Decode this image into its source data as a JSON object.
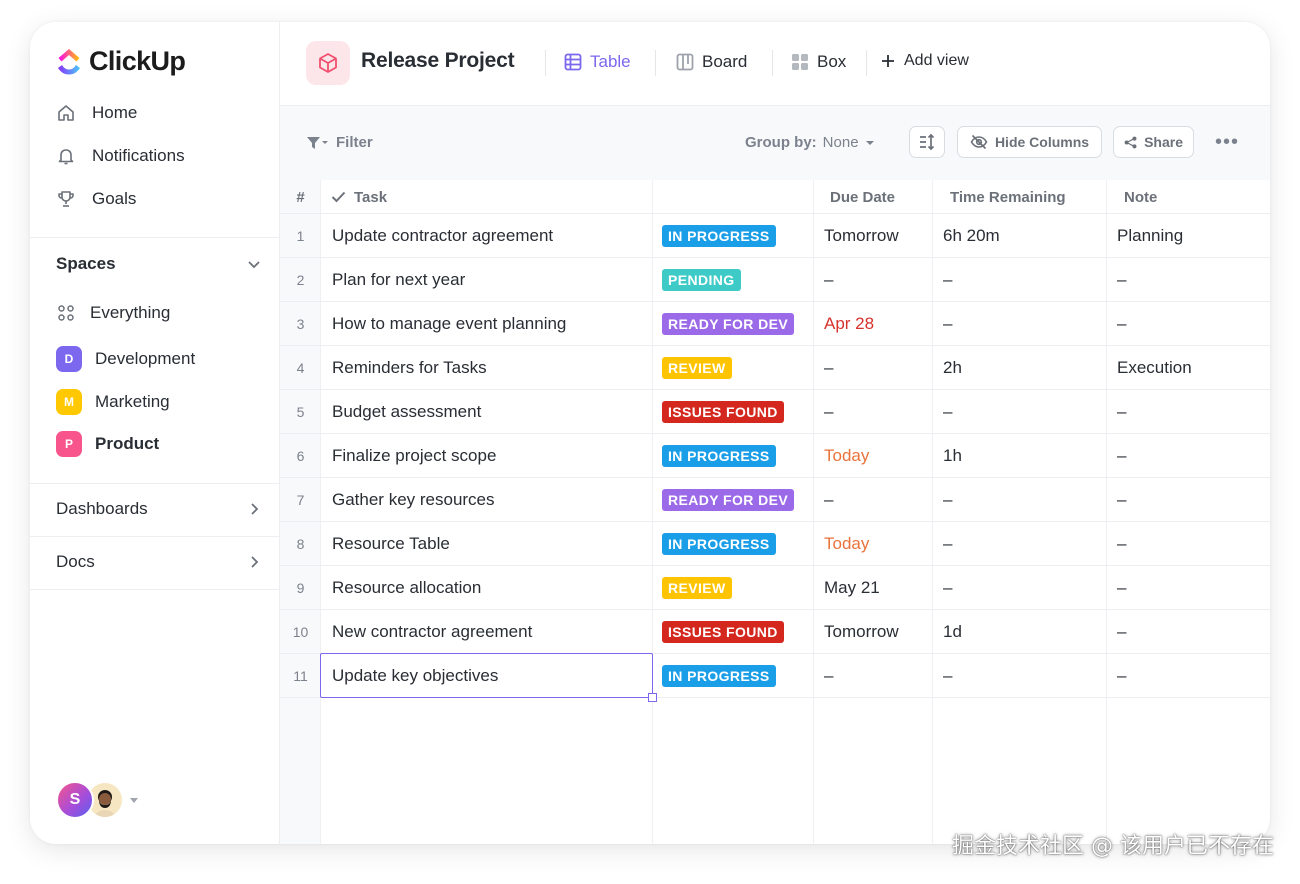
{
  "app": {
    "name": "ClickUp"
  },
  "sidebar": {
    "nav": [
      {
        "label": "Home",
        "icon": "home-icon"
      },
      {
        "label": "Notifications",
        "icon": "bell-icon"
      },
      {
        "label": "Goals",
        "icon": "trophy-icon"
      }
    ],
    "spaces_title": "Spaces",
    "everything_label": "Everything",
    "spaces": [
      {
        "letter": "D",
        "label": "Development",
        "color": "#7b68ee"
      },
      {
        "letter": "M",
        "label": "Marketing",
        "color": "#ffc800"
      },
      {
        "letter": "P",
        "label": "Product",
        "color": "#f7558c"
      }
    ],
    "dashboards_label": "Dashboards",
    "docs_label": "Docs",
    "avatar_letter": "S"
  },
  "header": {
    "project_title": "Release Project",
    "views": [
      {
        "label": "Table",
        "icon": "table-icon",
        "active": true
      },
      {
        "label": "Board",
        "icon": "board-icon",
        "active": false
      },
      {
        "label": "Box",
        "icon": "box-icon",
        "active": false
      }
    ],
    "add_view_label": "Add view"
  },
  "toolbar": {
    "filter_label": "Filter",
    "group_by_label": "Group by:",
    "group_by_value": "None",
    "hide_columns_label": "Hide Columns",
    "share_label": "Share"
  },
  "table": {
    "columns": {
      "num": "#",
      "task": "Task",
      "status": "",
      "due": "Due Date",
      "time": "Time Remaining",
      "note": "Note"
    },
    "rows": [
      {
        "num": "1",
        "task": "Update contractor agreement",
        "status": "IN PROGRESS",
        "status_color": "#1b9ee8",
        "due": "Tomorrow",
        "due_color": "#292d34",
        "time": "6h 20m",
        "note": "Planning"
      },
      {
        "num": "2",
        "task": "Plan for next year",
        "status": "PENDING",
        "status_color": "#3ecbc8",
        "due": "–",
        "due_color": "#292d34",
        "time": "–",
        "note": "–"
      },
      {
        "num": "3",
        "task": "How to manage event planning",
        "status": "READY FOR DEV",
        "status_color": "#9b6ae8",
        "due": "Apr 28",
        "due_color": "#d8322d",
        "time": "–",
        "note": "–"
      },
      {
        "num": "4",
        "task": "Reminders for Tasks",
        "status": "REVIEW",
        "status_color": "#ffc400",
        "due": "–",
        "due_color": "#292d34",
        "time": "2h",
        "note": "Execution"
      },
      {
        "num": "5",
        "task": "Budget assessment",
        "status": "ISSUES FOUND",
        "status_color": "#d4281f",
        "due": "–",
        "due_color": "#292d34",
        "time": "–",
        "note": "–"
      },
      {
        "num": "6",
        "task": "Finalize project scope",
        "status": "IN PROGRESS",
        "status_color": "#1b9ee8",
        "due": "Today",
        "due_color": "#e8733b",
        "time": "1h",
        "note": "–"
      },
      {
        "num": "7",
        "task": "Gather key resources",
        "status": "READY FOR DEV",
        "status_color": "#9b6ae8",
        "due": "–",
        "due_color": "#292d34",
        "time": "–",
        "note": "–"
      },
      {
        "num": "8",
        "task": "Resource Table",
        "status": "IN PROGRESS",
        "status_color": "#1b9ee8",
        "due": "Today",
        "due_color": "#e8733b",
        "time": "–",
        "note": "–"
      },
      {
        "num": "9",
        "task": "Resource allocation",
        "status": "REVIEW",
        "status_color": "#ffc400",
        "due": "May 21",
        "due_color": "#292d34",
        "time": "–",
        "note": "–"
      },
      {
        "num": "10",
        "task": "New contractor agreement",
        "status": "ISSUES FOUND",
        "status_color": "#d4281f",
        "due": "Tomorrow",
        "due_color": "#292d34",
        "time": "1d",
        "note": "–"
      },
      {
        "num": "11",
        "task": "Update key objectives",
        "status": "IN PROGRESS",
        "status_color": "#1b9ee8",
        "due": "–",
        "due_color": "#292d34",
        "time": "–",
        "note": "–"
      }
    ]
  },
  "watermark": "掘金技术社区 @ 该用户已不存在"
}
